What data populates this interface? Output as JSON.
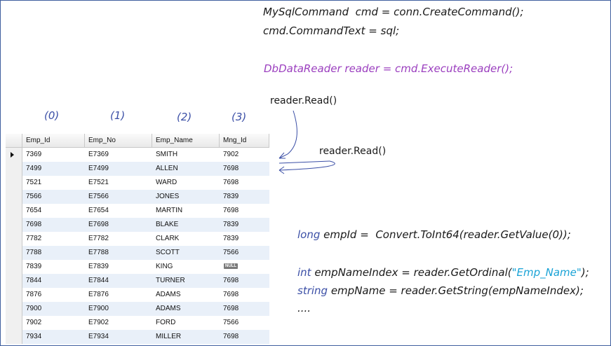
{
  "code": {
    "line1": "MySqlCommand  cmd = conn.CreateCommand();",
    "line2": "cmd.CommandText = sql;",
    "line3": "DbDataReader reader = cmd.ExecuteReader();",
    "read1": "reader.Read()",
    "read2": "reader.Read()",
    "line4": "long empId =  Convert.ToInt64(reader.GetValue(0));",
    "line5_a": "int",
    "line5_b": " empNameIndex = reader.GetOrdinal(",
    "line5_str": "\"Emp_Name\"",
    "line5_c": ");",
    "line6_a": "string",
    "line6_b": " empName = reader.GetString(empNameIndex);",
    "line7": "....",
    "line4_kw": "long",
    "line4_rest": " empId =  Convert.ToInt64(reader.GetValue(0));"
  },
  "indices": [
    "(0)",
    "(1)",
    "(2)",
    "(3)"
  ],
  "grid": {
    "columns": [
      "Emp_Id",
      "Emp_No",
      "Emp_Name",
      "Mng_Id"
    ],
    "null_label": "NULL",
    "rows": [
      [
        "7369",
        "E7369",
        "SMITH",
        "7902"
      ],
      [
        "7499",
        "E7499",
        "ALLEN",
        "7698"
      ],
      [
        "7521",
        "E7521",
        "WARD",
        "7698"
      ],
      [
        "7566",
        "E7566",
        "JONES",
        "7839"
      ],
      [
        "7654",
        "E7654",
        "MARTIN",
        "7698"
      ],
      [
        "7698",
        "E7698",
        "BLAKE",
        "7839"
      ],
      [
        "7782",
        "E7782",
        "CLARK",
        "7839"
      ],
      [
        "7788",
        "E7788",
        "SCOTT",
        "7566"
      ],
      [
        "7839",
        "E7839",
        "KING",
        null
      ],
      [
        "7844",
        "E7844",
        "TURNER",
        "7698"
      ],
      [
        "7876",
        "E7876",
        "ADAMS",
        "7698"
      ],
      [
        "7900",
        "E7900",
        "ADAMS",
        "7698"
      ],
      [
        "7902",
        "E7902",
        "FORD",
        "7566"
      ],
      [
        "7934",
        "E7934",
        "MILLER",
        "7698"
      ]
    ]
  },
  "colors": {
    "purple": "#9b3fbf",
    "keyword_blue": "#3b4fa6",
    "string_cyan": "#1aa3d6",
    "alt_row": "#e9f0f9"
  }
}
